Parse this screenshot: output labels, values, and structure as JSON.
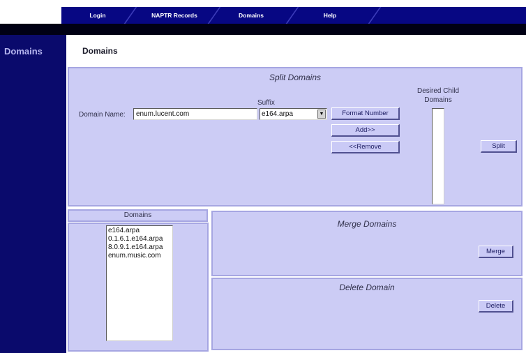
{
  "nav": {
    "tabs": [
      {
        "label": "Login"
      },
      {
        "label": "NAPTR Records"
      },
      {
        "label": "Domains"
      },
      {
        "label": "Help"
      }
    ]
  },
  "sidebar": {
    "title": "Domains"
  },
  "page": {
    "title": "Domains"
  },
  "split": {
    "title": "Split Domains",
    "suffix_label": "Suffix",
    "domain_name_label": "Domain Name:",
    "domain_name_value": "enum.lucent.com",
    "suffix_selected": "e164.arpa",
    "format_number_label": "Format Number",
    "add_label": "Add>>",
    "remove_label": "<<Remove",
    "desired_child_label_line1": "Desired Child",
    "desired_child_label_line2": "Domains",
    "split_label": "Split"
  },
  "domains": {
    "header": "Domains",
    "items": [
      "e164.arpa",
      "0.1.6.1.e164.arpa",
      "8.0.9.1.e164.arpa",
      "enum.music.com"
    ]
  },
  "merge": {
    "title": "Merge Domains",
    "button_label": "Merge"
  },
  "delete": {
    "title": "Delete Domain",
    "button_label": "Delete"
  },
  "colors": {
    "nav_bg": "#070783",
    "sidebar_bg": "#0a0a6c",
    "panel_bg": "#ccccf5",
    "panel_border": "#a6a6e2"
  }
}
